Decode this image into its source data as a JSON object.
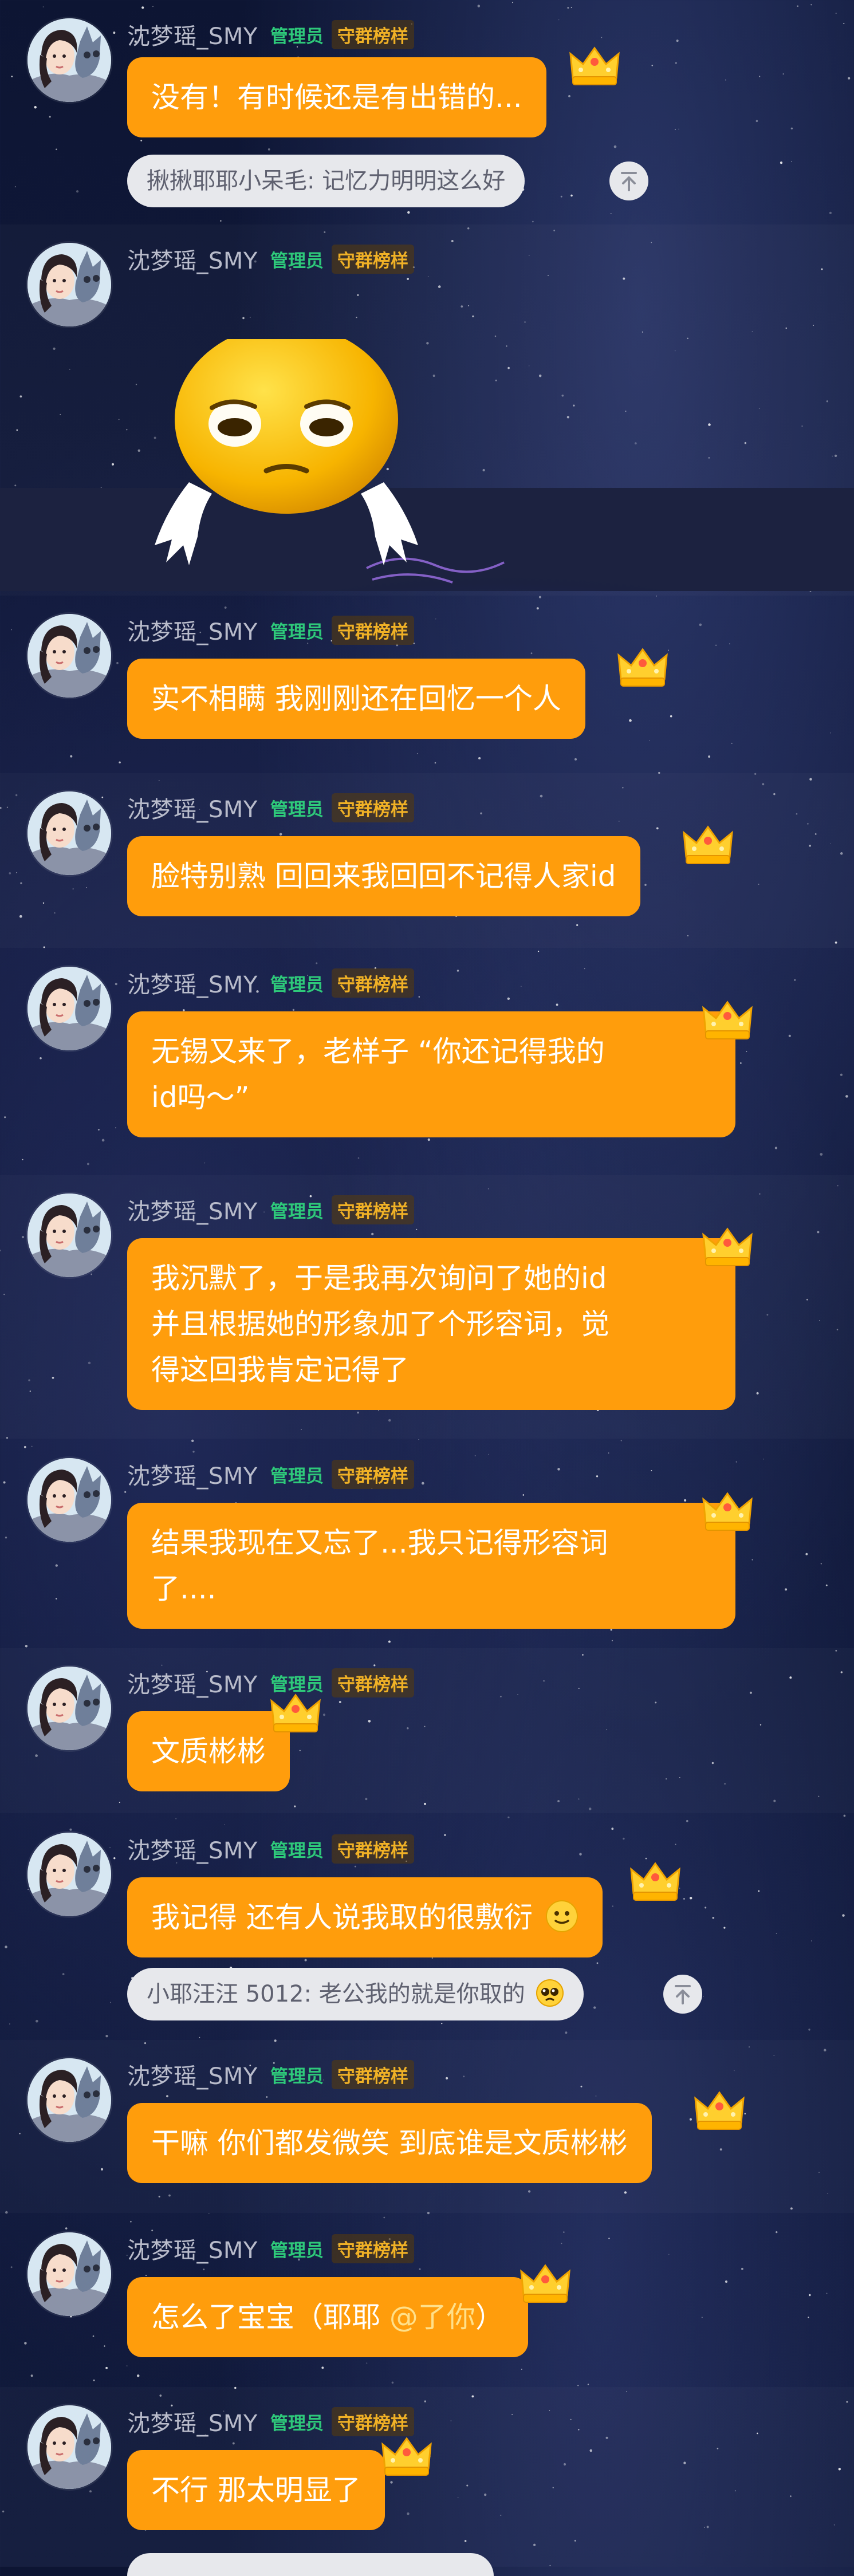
{
  "user": {
    "username": "沈梦瑶_SMY",
    "badge_admin": "管理员",
    "badge_guard": "守群榜样"
  },
  "messages": [
    {
      "text": "没有！有时候还是有出错的..."
    },
    {
      "sticker": "crying-smiley-sticker"
    },
    {
      "text": "实不相瞒 我刚刚还在回忆一个人"
    },
    {
      "text": "脸特别熟 回回来我回回不记得人家id"
    },
    {
      "line1": "无锡又来了，老样子 “你还记得我的",
      "line2": "id吗～”"
    },
    {
      "line1": "我沉默了，于是我再次询问了她的id",
      "line2": "并且根据她的形象加了个形容词，觉",
      "line3": "得这回我肯定记得了"
    },
    {
      "line1": "结果我现在又忘了...我只记得形容词",
      "line2": "了...."
    },
    {
      "text": "文质彬彬"
    },
    {
      "text": "我记得 还有人说我取的很敷衍"
    },
    {
      "text": "干嘛 你们都发微笑 到底谁是文质彬彬"
    },
    {
      "text": "怎么了宝宝（耶耶 ",
      "mention": "@了你",
      "tail": "）"
    },
    {
      "text": "不行 那太明显了"
    }
  ],
  "quotes": {
    "q1": "揪揪耶耶小呆毛: 记忆力明明这么好",
    "q2": "小耶汪汪 5012: 老公我的就是你取的"
  },
  "icons": {
    "crown": "crown-icon",
    "reply": "arrow-up-icon",
    "smile": "smile-emoji-icon",
    "pleading": "pleading-emoji-icon"
  },
  "colors": {
    "bubble": "#ff9d0c",
    "admin_badge": "#2ec97a",
    "guard_badge": "#f0b126",
    "quote_bg": "#e7e8ec"
  }
}
